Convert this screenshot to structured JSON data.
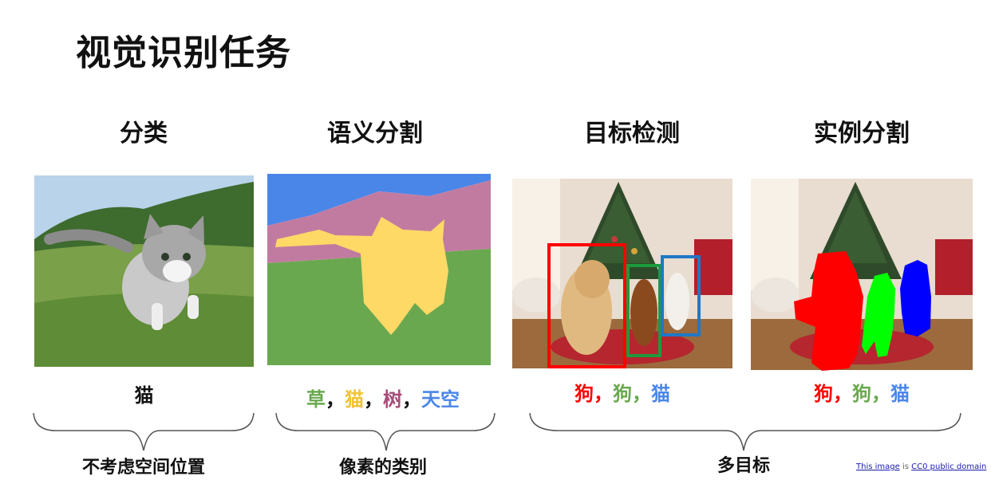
{
  "title": "视觉识别任务",
  "tasks": [
    {
      "heading": "分类",
      "caption": [
        {
          "text": "猫",
          "color": "#111111"
        }
      ]
    },
    {
      "heading": "语义分割",
      "caption": [
        {
          "text": "草",
          "color": "#6aa84f"
        },
        {
          "text": "，",
          "color": "#111111"
        },
        {
          "text": "猫",
          "color": "#f1c232"
        },
        {
          "text": "，",
          "color": "#111111"
        },
        {
          "text": "树",
          "color": "#a64d79"
        },
        {
          "text": "，",
          "color": "#111111"
        },
        {
          "text": "天空",
          "color": "#4a86e8"
        }
      ]
    },
    {
      "heading": "目标检测",
      "caption": [
        {
          "text": "狗",
          "color": "#ff0000"
        },
        {
          "text": "，",
          "color": "#ff0000"
        },
        {
          "text": "狗",
          "color": "#6aa84f"
        },
        {
          "text": "，",
          "color": "#6aa84f"
        },
        {
          "text": "猫",
          "color": "#4a86e8"
        }
      ]
    },
    {
      "heading": "实例分割",
      "caption": [
        {
          "text": "狗",
          "color": "#ff0000"
        },
        {
          "text": "，",
          "color": "#ff0000"
        },
        {
          "text": "狗",
          "color": "#6aa84f"
        },
        {
          "text": "，",
          "color": "#6aa84f"
        },
        {
          "text": "猫",
          "color": "#4a86e8"
        }
      ]
    }
  ],
  "groups": [
    "不考虑空间位置",
    "像素的类别",
    "多目标"
  ],
  "credit": {
    "link": "This image",
    "is": "is",
    "license": "CC0 public domain"
  },
  "colors": {
    "sky": "#4a86e8",
    "tree": "#c27ba0",
    "grass": "#6aa84f",
    "cat": "#ffd966",
    "box_dog1": "#ff0000",
    "box_dog2": "#1c9b3c",
    "box_cat": "#1f78c8",
    "mask_dog1": "#ff0000",
    "mask_dog2": "#00ff00",
    "mask_cat": "#0000ff"
  }
}
